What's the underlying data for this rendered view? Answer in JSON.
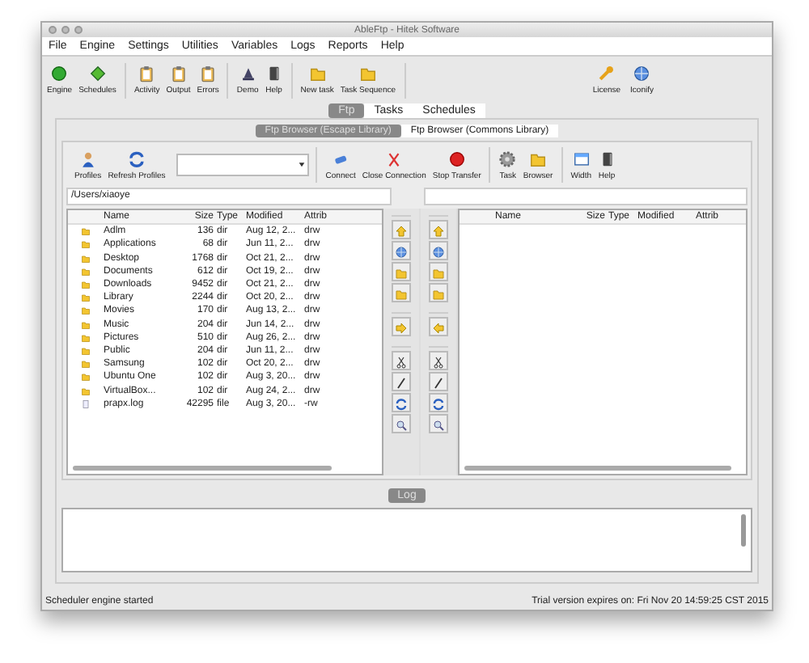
{
  "window": {
    "title": "AbleFtp  - Hitek Software"
  },
  "menu": [
    "File",
    "Engine",
    "Settings",
    "Utilities",
    "Variables",
    "Logs",
    "Reports",
    "Help"
  ],
  "toolbar": {
    "groups": [
      [
        "Engine",
        "Schedules"
      ],
      [
        "Activity",
        "Output",
        "Errors"
      ],
      [
        "Demo",
        "Help"
      ],
      [
        "New task",
        "Task Sequence"
      ]
    ],
    "right": [
      "License",
      "Iconify"
    ]
  },
  "tabs": [
    {
      "label": "Ftp",
      "selected": true
    },
    {
      "label": "Tasks",
      "selected": false
    },
    {
      "label": "Schedules",
      "selected": false
    }
  ],
  "subtabs": [
    {
      "label": "Ftp Browser (Escape Library)",
      "selected": true
    },
    {
      "label": "Ftp Browser (Commons Library)",
      "selected": false
    }
  ],
  "ftp_toolbar": {
    "left": [
      "Profiles",
      "Refresh Profiles"
    ],
    "middle": [
      "Connect",
      "Close Connection",
      "Stop Transfer"
    ],
    "task": [
      "Task",
      "Browser"
    ],
    "view": [
      "Width",
      "Help"
    ]
  },
  "local": {
    "path": "/Users/xiaoye",
    "columns": [
      "Name",
      "Size",
      "Type",
      "Modified",
      "Attrib"
    ],
    "rows": [
      {
        "kind": "folder",
        "name": "Adlm",
        "size": "136",
        "type": "dir",
        "modified": "Aug 12, 2...",
        "attrib": "drw"
      },
      {
        "kind": "folder",
        "name": "Applications",
        "size": "68",
        "type": "dir",
        "modified": "Jun 11, 2...",
        "attrib": "drw"
      },
      {
        "kind": "folder",
        "name": "Desktop",
        "size": "1768",
        "type": "dir",
        "modified": "Oct 21, 2...",
        "attrib": "drw"
      },
      {
        "kind": "folder",
        "name": "Documents",
        "size": "612",
        "type": "dir",
        "modified": "Oct 19, 2...",
        "attrib": "drw"
      },
      {
        "kind": "folder",
        "name": "Downloads",
        "size": "9452",
        "type": "dir",
        "modified": "Oct 21, 2...",
        "attrib": "drw"
      },
      {
        "kind": "folder",
        "name": "Library",
        "size": "2244",
        "type": "dir",
        "modified": "Oct 20, 2...",
        "attrib": "drw"
      },
      {
        "kind": "folder",
        "name": "Movies",
        "size": "170",
        "type": "dir",
        "modified": "Aug 13, 2...",
        "attrib": "drw"
      },
      {
        "kind": "folder",
        "name": "Music",
        "size": "204",
        "type": "dir",
        "modified": "Jun 14, 2...",
        "attrib": "drw"
      },
      {
        "kind": "folder",
        "name": "Pictures",
        "size": "510",
        "type": "dir",
        "modified": "Aug 26, 2...",
        "attrib": "drw"
      },
      {
        "kind": "folder",
        "name": "Public",
        "size": "204",
        "type": "dir",
        "modified": "Jun 11, 2...",
        "attrib": "drw"
      },
      {
        "kind": "folder",
        "name": "Samsung",
        "size": "102",
        "type": "dir",
        "modified": "Oct 20, 2...",
        "attrib": "drw"
      },
      {
        "kind": "folder",
        "name": "Ubuntu One",
        "size": "102",
        "type": "dir",
        "modified": "Aug 3, 20...",
        "attrib": "drw"
      },
      {
        "kind": "folder",
        "name": "VirtualBox...",
        "size": "102",
        "type": "dir",
        "modified": "Aug 24, 2...",
        "attrib": "drw"
      },
      {
        "kind": "file",
        "name": "prapx.log",
        "size": "42295",
        "type": "file",
        "modified": "Aug 3, 20...",
        "attrib": "-rw"
      }
    ]
  },
  "remote": {
    "columns": [
      "Name",
      "Size",
      "Type",
      "Modified",
      "Attrib"
    ]
  },
  "log_tab": {
    "label": "Log"
  },
  "status_bar": {
    "left": "Scheduler engine started",
    "right": "Trial version expires on: Fri Nov 20 14:59:25 CST 2015"
  }
}
